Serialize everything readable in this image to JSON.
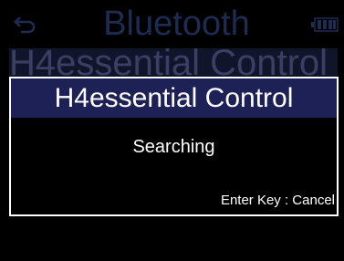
{
  "header": {
    "title": "Bluetooth",
    "back_icon": "back-arrow-icon",
    "battery_icon": "battery-icon"
  },
  "background_menu": {
    "selected_item": "H4essential Control"
  },
  "dialog": {
    "title": "H4essential Control",
    "message": "Searching",
    "hint": "Enter Key : Cancel"
  },
  "colors": {
    "background": "#000000",
    "dialog_title_bar": "#1e2156",
    "dimmed_text": "#1f2c52",
    "text": "#ffffff"
  }
}
